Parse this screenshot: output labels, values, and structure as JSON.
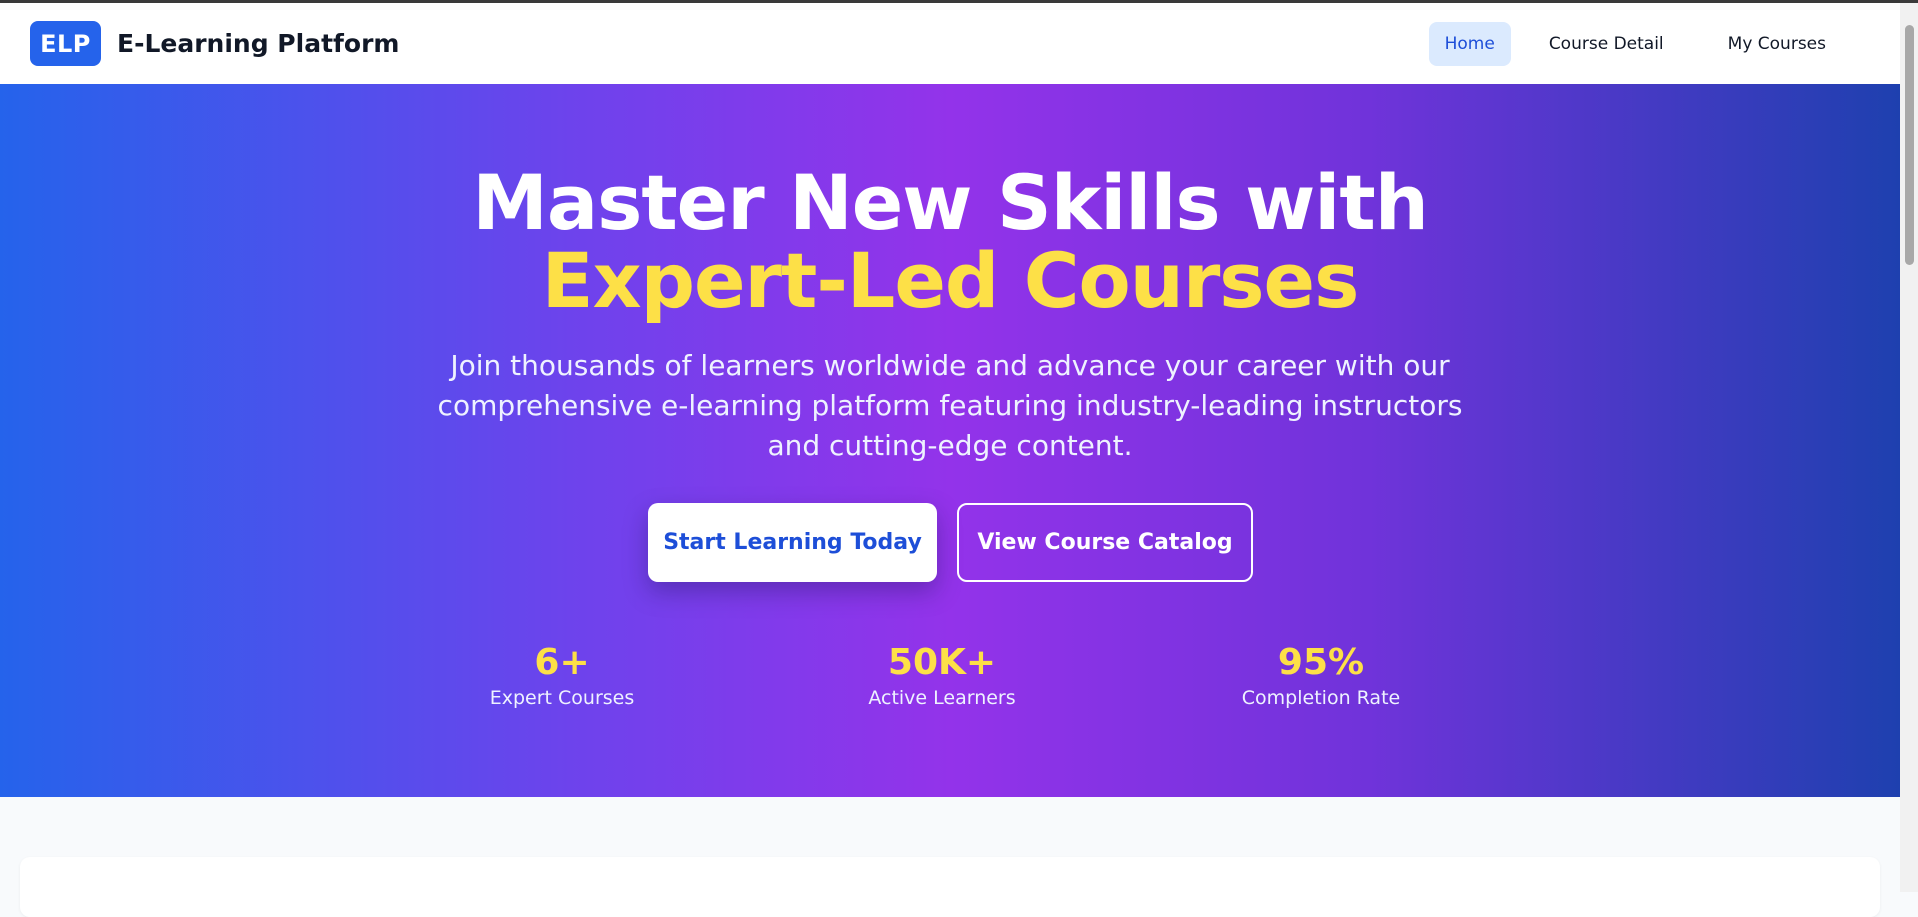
{
  "navbar": {
    "logo_text": "ELP",
    "brand": "E-Learning Platform",
    "links": [
      {
        "label": "Home",
        "active": true
      },
      {
        "label": "Course Detail",
        "active": false
      },
      {
        "label": "My Courses",
        "active": false
      }
    ]
  },
  "hero": {
    "title_line1": "Master New Skills with",
    "title_line2": "Expert-Led Courses",
    "subtitle": "Join thousands of learners worldwide and advance your career with our comprehensive e-learning platform featuring industry-leading instructors and cutting-edge content.",
    "primary_button": "Start Learning Today",
    "secondary_button": "View Course Catalog",
    "stats": [
      {
        "value": "6+",
        "label": "Expert Courses"
      },
      {
        "value": "50K+",
        "label": "Active Learners"
      },
      {
        "value": "95%",
        "label": "Completion Rate"
      }
    ]
  },
  "colors": {
    "brand": "#2563eb",
    "accent_yellow": "#fde047",
    "gradient_mid": "#9333ea",
    "active_nav_bg": "#dbeafe"
  }
}
